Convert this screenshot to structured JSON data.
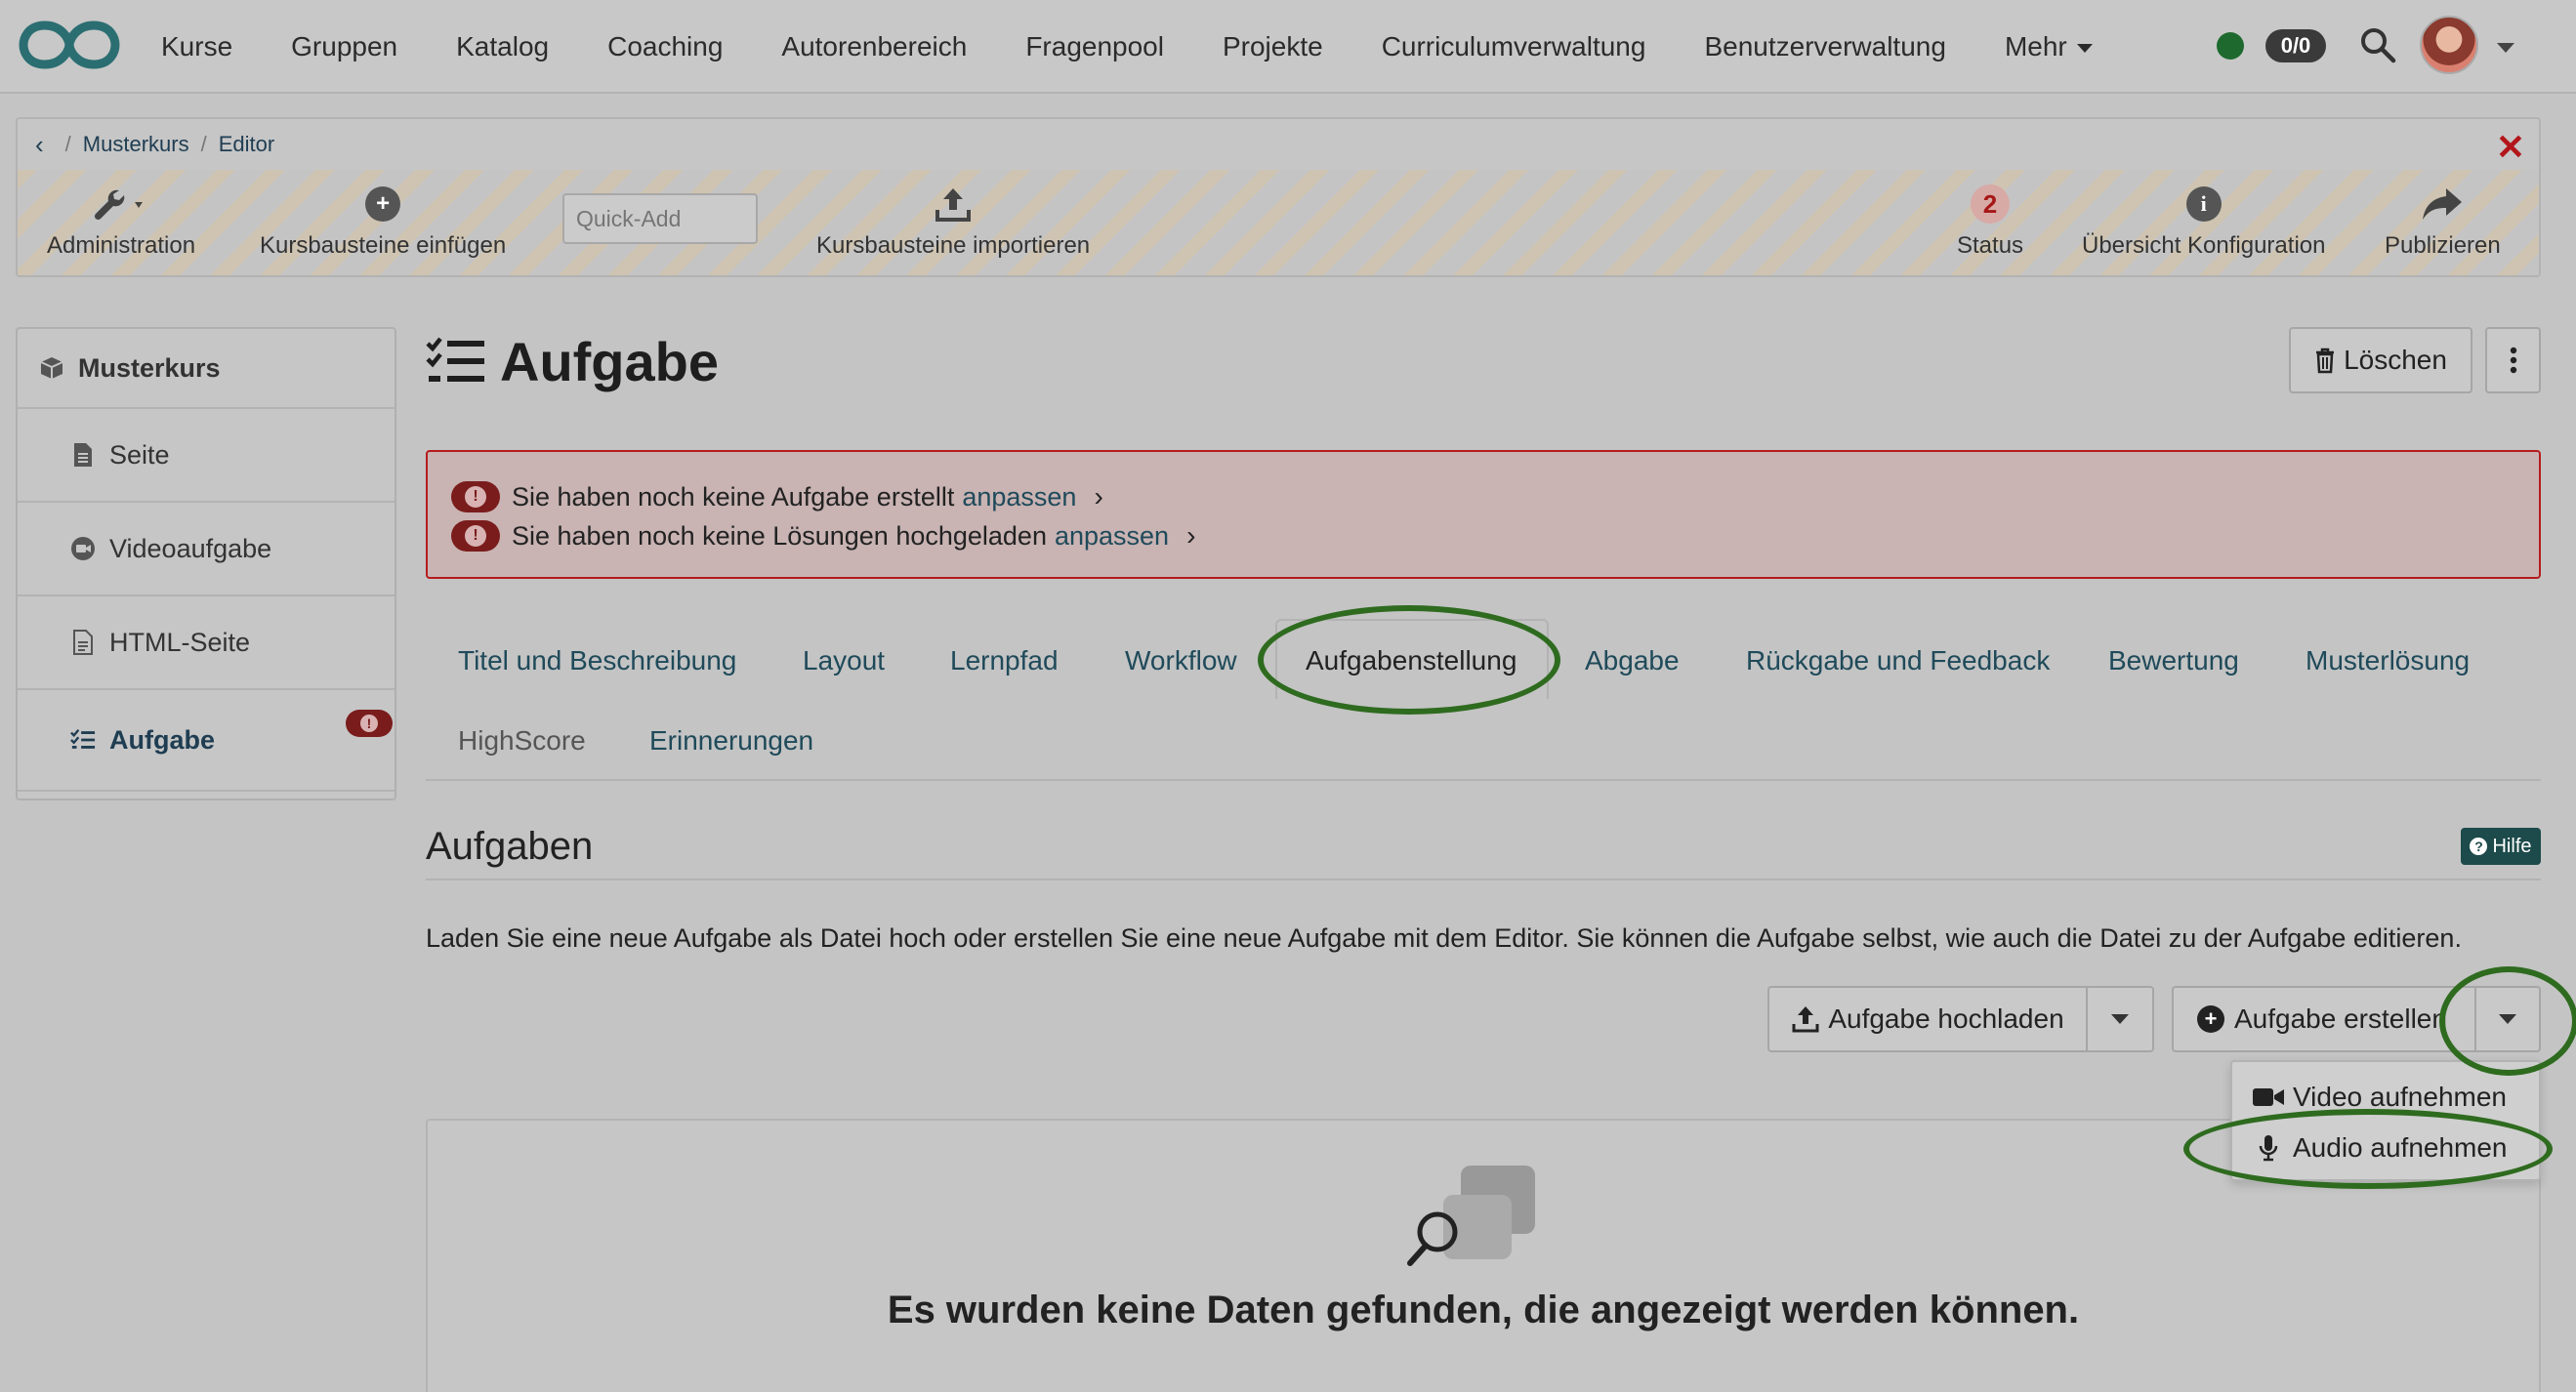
{
  "nav": {
    "items": [
      "Kurse",
      "Gruppen",
      "Katalog",
      "Coaching",
      "Autorenbereich",
      "Fragenpool",
      "Projekte",
      "Curriculumverwaltung",
      "Benutzerverwaltung",
      "Mehr"
    ],
    "count_badge": "0/0",
    "status_color": "#1e6a2e"
  },
  "breadcrumb": {
    "items": [
      "Musterkurs",
      "Editor"
    ]
  },
  "toolbar": {
    "administration": "Administration",
    "insert_blocks": "Kursbausteine einfügen",
    "quick_add_placeholder": "Quick-Add",
    "import_blocks": "Kursbausteine importieren",
    "status_count": "2",
    "status": "Status",
    "overview_config": "Übersicht Konfiguration",
    "publish": "Publizieren"
  },
  "sidebar": {
    "root": "Musterkurs",
    "items": [
      {
        "label": "Seite",
        "icon": "file-icon"
      },
      {
        "label": "Videoaufgabe",
        "icon": "video-icon"
      },
      {
        "label": "HTML-Seite",
        "icon": "html-file-icon"
      },
      {
        "label": "Aufgabe",
        "icon": "task-list-icon",
        "active": true,
        "warning": true
      }
    ]
  },
  "main": {
    "title": "Aufgabe",
    "delete": "Löschen",
    "alerts": [
      {
        "text": "Sie haben noch keine Aufgabe erstellt",
        "link": "anpassen"
      },
      {
        "text": "Sie haben noch keine Lösungen hochgeladen",
        "link": "anpassen"
      }
    ],
    "tabs": [
      "Titel und Beschreibung",
      "Layout",
      "Lernpfad",
      "Workflow",
      "Aufgabenstellung",
      "Abgabe",
      "Rückgabe und Feedback",
      "Bewertung",
      "Musterlösung",
      "HighScore",
      "Erinnerungen"
    ],
    "active_tab": "Aufgabenstellung",
    "section_title": "Aufgaben",
    "help": "Hilfe",
    "description": "Laden Sie eine neue Aufgabe als Datei hoch oder erstellen Sie eine neue Aufgabe mit dem Editor. Sie können die Aufgabe selbst, wie auch die Datei zu der Aufgabe editieren.",
    "upload_button": "Aufgabe hochladen",
    "create_button": "Aufgabe erstellen",
    "dropdown": [
      "Video aufnehmen",
      "Audio aufnehmen"
    ],
    "empty_text": "Es wurden keine Daten gefunden, die angezeigt werden können."
  },
  "colors": {
    "accent_link": "#1f4a5a",
    "danger": "#b61c1c",
    "highlight_ring": "#2e6b1f"
  }
}
